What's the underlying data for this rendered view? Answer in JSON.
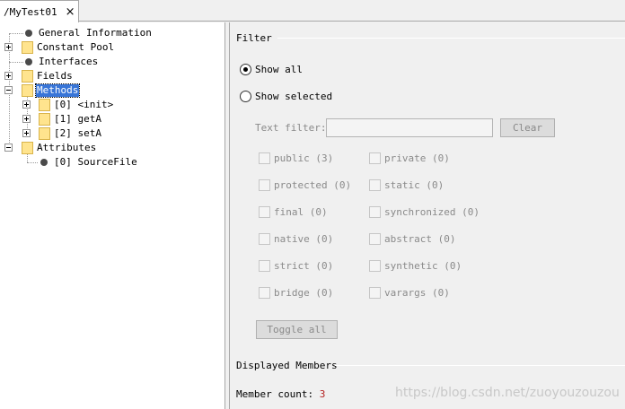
{
  "tab": {
    "title": "/MyTest01",
    "close_icon": "×"
  },
  "tree": {
    "nodes": [
      {
        "label": "General Information"
      },
      {
        "label": "Constant Pool"
      },
      {
        "label": "Interfaces"
      },
      {
        "label": "Fields"
      },
      {
        "label": "Methods"
      },
      {
        "label": "[0] <init>"
      },
      {
        "label": "[1] getA"
      },
      {
        "label": "[2] setA"
      },
      {
        "label": "Attributes"
      },
      {
        "label": "[0] SourceFile"
      }
    ],
    "selected": "Methods"
  },
  "filter": {
    "title": "Filter",
    "show_all": "Show all",
    "show_selected": "Show selected",
    "selected_mode": "show_all",
    "text_filter_label": "Text filter:",
    "text_filter_value": "",
    "clear_label": "Clear",
    "modifiers_left": [
      {
        "label": "public (3)"
      },
      {
        "label": "protected (0)"
      },
      {
        "label": "final (0)"
      },
      {
        "label": "native (0)"
      },
      {
        "label": "strict (0)"
      },
      {
        "label": "bridge (0)"
      }
    ],
    "modifiers_right": [
      {
        "label": "private (0)"
      },
      {
        "label": "static (0)"
      },
      {
        "label": "synchronized (0)"
      },
      {
        "label": "abstract (0)"
      },
      {
        "label": "synthetic (0)"
      },
      {
        "label": "varargs (0)"
      }
    ],
    "toggle_all_label": "Toggle all"
  },
  "displayed": {
    "title": "Displayed Members",
    "member_count_label": "Member count:",
    "member_count": "3"
  },
  "watermark": "https://blog.csdn.net/zuoyouzouzou",
  "colors": {
    "selection": "#3875d7",
    "count": "#b42020",
    "folder": "#ffe48e"
  }
}
